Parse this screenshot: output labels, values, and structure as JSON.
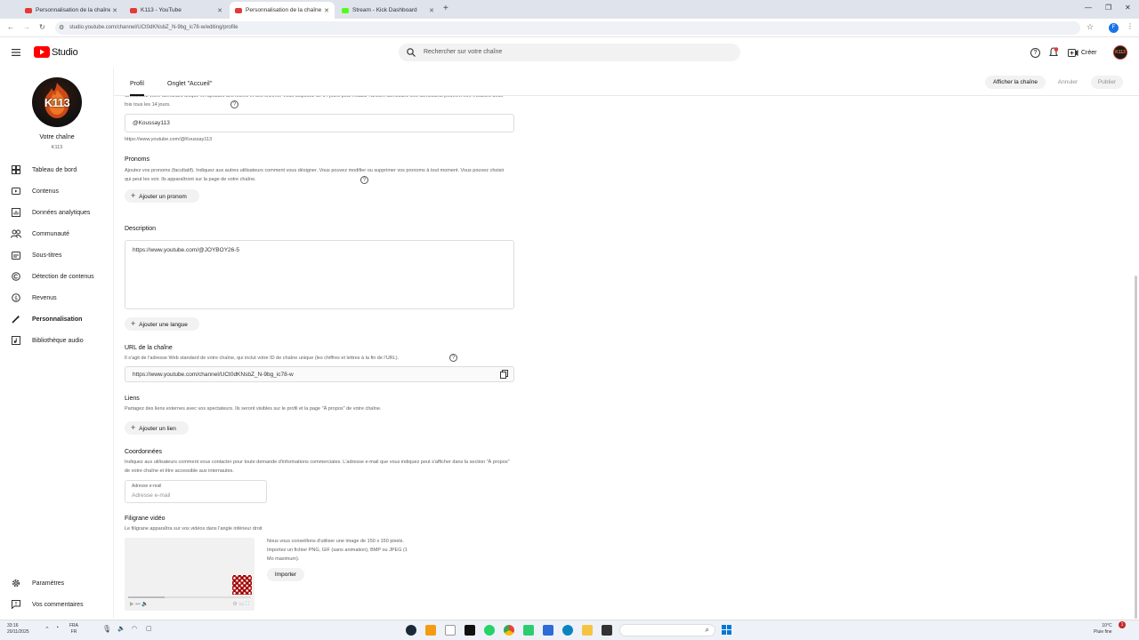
{
  "browser": {
    "tabs": [
      {
        "title": "Personnalisation de la chaîne",
        "active": false,
        "color": "#e53935"
      },
      {
        "title": "K113 - YouTube",
        "active": false,
        "color": "#e53935"
      },
      {
        "title": "Personnalisation de la chaîne",
        "active": true,
        "color": "#e53935"
      },
      {
        "title": "Stream - Kick Dashboard",
        "active": false,
        "color": "#53fc18"
      }
    ],
    "url": "studio.youtube.com/channel/UCt0dKNsbZ_N-9bg_ic78-w/editing/profile"
  },
  "header": {
    "logo_text": "Studio",
    "search_placeholder": "Rechercher sur votre chaîne",
    "create_label": "Créer",
    "avatar_text": "K113"
  },
  "sidebar": {
    "channel_label": "Votre chaîne",
    "channel_name": "K113",
    "avatar_text": "K113",
    "items": [
      {
        "label": "Tableau de bord",
        "icon": "dashboard-icon"
      },
      {
        "label": "Contenus",
        "icon": "content-icon"
      },
      {
        "label": "Données analytiques",
        "icon": "analytics-icon"
      },
      {
        "label": "Communauté",
        "icon": "community-icon"
      },
      {
        "label": "Sous-titres",
        "icon": "subtitles-icon"
      },
      {
        "label": "Détection de contenus",
        "icon": "copyright-icon"
      },
      {
        "label": "Revenus",
        "icon": "money-icon"
      },
      {
        "label": "Personnalisation",
        "icon": "customization-icon"
      },
      {
        "label": "Bibliothèque audio",
        "icon": "audio-library-icon"
      }
    ],
    "settings_label": "Paramètres",
    "feedback_label": "Vos commentaires"
  },
  "tabs": {
    "profile": "Profil",
    "home": "Onglet \"Accueil\"",
    "view_channel": "Afficher la chaîne",
    "cancel": "Annuler",
    "publish": "Publier"
  },
  "main": {
    "handle_desc": "Choisissez votre identifiant unique en ajoutant des lettres et des chiffres. Vous disposez de 14 jours pour rétablir l'ancien identifiant. Les identifiants peuvent être modifiés deux fois tous les 14 jours.",
    "handle_value": "@Koussay113",
    "handle_url": "https://www.youtube.com/@Koussay113",
    "pronouns_title": "Pronoms",
    "pronouns_desc": "Ajoutez vos pronoms (facultatif). Indiquez aux autres utilisateurs comment vous désigner. Vous pouvez modifier ou supprimer vos pronoms à tout moment. Vous pouvez choisir qui peut les voir. Ils apparaîtront sur la page de votre chaîne.",
    "add_pronoun": "Ajouter un pronom",
    "description_title": "Description",
    "description_value": "https://www.youtube.com/@JOYBOY26-5",
    "add_language": "Ajouter une langue",
    "url_title": "URL de la chaîne",
    "url_desc": "Il s'agit de l'adresse Web standard de votre chaîne, qui inclut votre ID de chaîne unique (les chiffres et lettres à la fin de l'URL).",
    "channel_url": "https://www.youtube.com/channel/UCt0dKNsbZ_N-9bg_ic78-w",
    "links_title": "Liens",
    "links_desc": "Partagez des liens externes avec vos spectateurs. Ils seront visibles sur le profil et la page \"À propos\" de votre chaîne.",
    "add_link": "Ajouter un lien",
    "contact_title": "Coordonnées",
    "contact_desc": "Indiquez aux utilisateurs comment vous contacter pour toute demande d'informations commerciales. L'adresse e-mail que vous indiquez peut s'afficher dans la section \"À propos\" de votre chaîne et être accessible aux internautes.",
    "email_label": "Adresse e-mail",
    "email_placeholder": "Adresse e-mail",
    "watermark_title": "Filigrane vidéo",
    "watermark_desc": "Le filigrane apparaîtra sur vos vidéos dans l'angle inférieur droit",
    "watermark_hint": "Nous vous conseillons d'utiliser une image de 150 x 150 pixels. Importez un fichier PNG, GIF (sans animation), BMP ou JPEG (1 Mo maximum).",
    "import": "Importer"
  },
  "taskbar": {
    "time": "33:16",
    "date": "20/11/2025",
    "lang": "FRA",
    "lang2": "FR",
    "weather_temp": "10°C",
    "weather_desc": "Pluie fine",
    "notif_count": "1"
  }
}
